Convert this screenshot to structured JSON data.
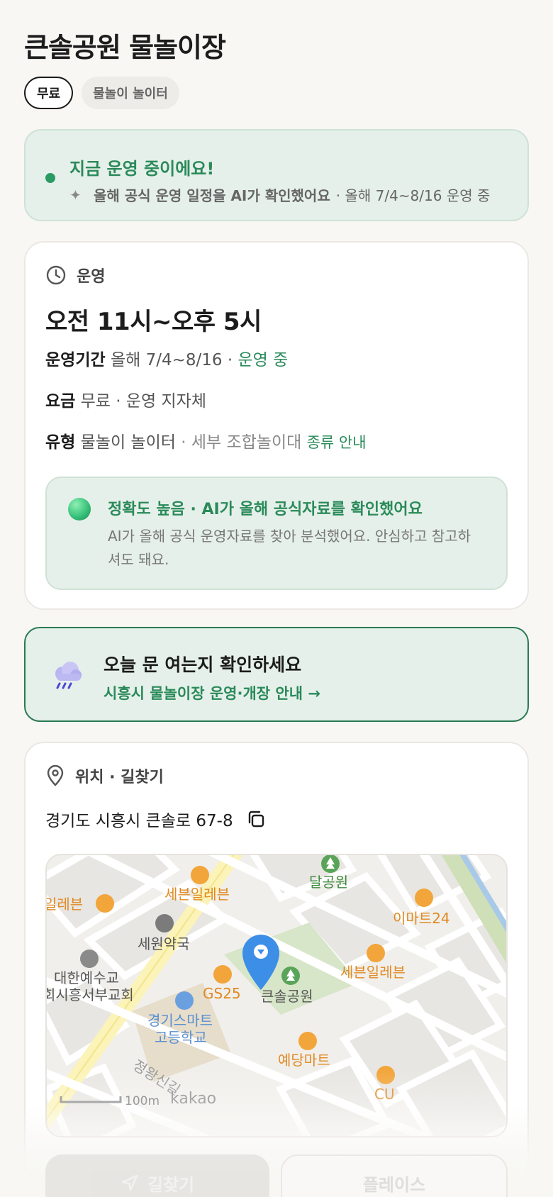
{
  "header": {
    "title": "큰솔공원 물놀이장"
  },
  "chips": {
    "free": "무료",
    "type": "물놀이 놀이터"
  },
  "status": {
    "title": "지금 운영 중이에요!",
    "sub_bold": "올해 공식 운영 일정을 AI가 확인했어요",
    "sub_rest": "· 올해 7/4~8/16 운영 중"
  },
  "hours": {
    "heading": "운영",
    "main": "오전 11시~오후 5시",
    "period_key": "운영기간",
    "period_val": "올해 7/4~8/16 ·",
    "period_status": "운영 중",
    "fee_key": "요금",
    "fee_val": "무료 · 운영 지자체",
    "type_key": "유형",
    "type_val": "물놀이 놀이터",
    "type_detail": "· 세부 조합놀이대",
    "type_link": "종류 안내"
  },
  "ai_box": {
    "title": "정확도 높음 · AI가 올해 공식자료를 확인했어요",
    "desc": "AI가 올해 공식 운영자료를 찾아 분석했어요. 안심하고 참고하셔도 돼요."
  },
  "cta": {
    "title": "오늘 문 여는지 확인하세요",
    "link": "시흥시 물놀이장 운영·개장 안내 →"
  },
  "location": {
    "heading": "위치 · 길찾기",
    "address": "경기도 시흥시 큰솔로 67-8"
  },
  "map": {
    "labels": {
      "park_top": "달공원",
      "seven1": "세븐일레븐",
      "seven_left": "일레븐",
      "emart": "이마트24",
      "pharmacy": "세원약국",
      "church1": "대한예수교",
      "church2": "회시흥서부교회",
      "gs25": "GS25",
      "park": "큰솔공원",
      "seven2": "세븐일레븐",
      "school1": "경기스마트",
      "school2": "고등학교",
      "mart": "예당마트",
      "cu": "CU",
      "road": "정왕신길",
      "scale": "100m",
      "brand": "kakao"
    }
  },
  "buttons": {
    "directions": "길찾기",
    "place": "플레이스"
  },
  "colors": {
    "accent": "#2a8a5a",
    "status_bg": "#e6f0ea",
    "pin": "#3d8ee6"
  }
}
